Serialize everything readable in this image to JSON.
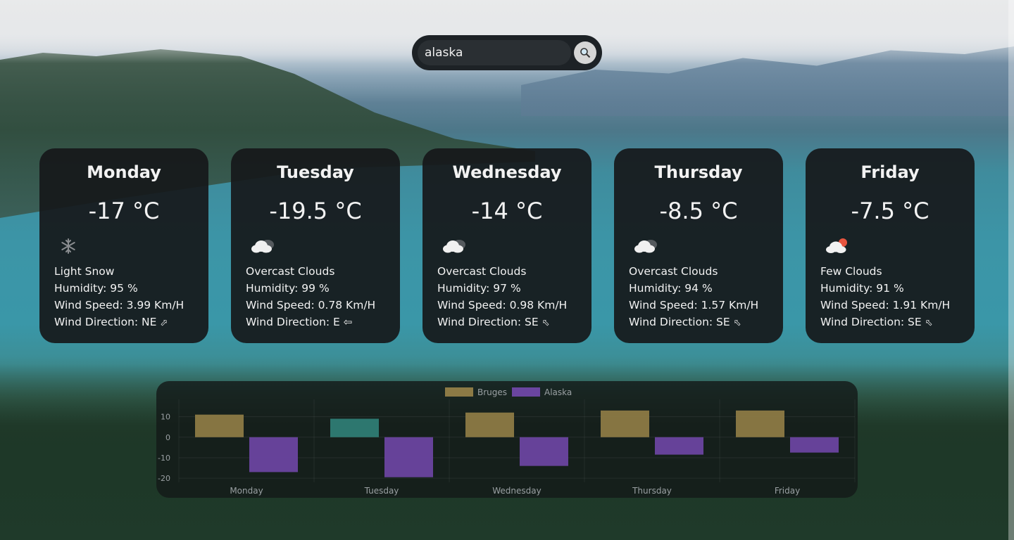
{
  "search": {
    "value": "alaska"
  },
  "cards": [
    {
      "day": "Monday",
      "temp": "-17 °C",
      "icon": "snow-icon",
      "desc": "Light Snow",
      "humidity": "Humidity: 95 %",
      "wind_speed": "Wind Speed: 3.99 Km/H",
      "wind_dir": "Wind Direction: NE",
      "arrow": "⬀"
    },
    {
      "day": "Tuesday",
      "temp": "-19.5 °C",
      "icon": "cloud-icon",
      "desc": "Overcast Clouds",
      "humidity": "Humidity: 99 %",
      "wind_speed": "Wind Speed: 0.78 Km/H",
      "wind_dir": "Wind Direction: E",
      "arrow": "⇦"
    },
    {
      "day": "Wednesday",
      "temp": "-14 °C",
      "icon": "cloud-icon",
      "desc": "Overcast Clouds",
      "humidity": "Humidity: 97 %",
      "wind_speed": "Wind Speed: 0.98 Km/H",
      "wind_dir": "Wind Direction: SE",
      "arrow": "⬁"
    },
    {
      "day": "Thursday",
      "temp": "-8.5 °C",
      "icon": "cloud-icon",
      "desc": "Overcast Clouds",
      "humidity": "Humidity: 94 %",
      "wind_speed": "Wind Speed: 1.57 Km/H",
      "wind_dir": "Wind Direction: SE",
      "arrow": "⬁"
    },
    {
      "day": "Friday",
      "temp": "-7.5 °C",
      "icon": "sun-cloud-icon",
      "desc": "Few Clouds",
      "humidity": "Humidity: 91 %",
      "wind_speed": "Wind Speed: 1.91 Km/H",
      "wind_dir": "Wind Direction: SE",
      "arrow": "⬁"
    }
  ],
  "chart_data": {
    "type": "bar",
    "categories": [
      "Monday",
      "Tuesday",
      "Wednesday",
      "Thursday",
      "Friday"
    ],
    "series": [
      {
        "name": "Bruges",
        "values": [
          11,
          9,
          12,
          13,
          13
        ],
        "color": "#8c7a45",
        "bar_colors": [
          "#8c7a45",
          "#2e7c74",
          "#8c7a45",
          "#8c7a45",
          "#8c7a45"
        ]
      },
      {
        "name": "Alaska",
        "values": [
          -17,
          -19.5,
          -14,
          -8.5,
          -7.5
        ],
        "color": "#6a45a0"
      }
    ],
    "yticks": [
      "10",
      "0",
      "-10",
      "-20"
    ],
    "ylim": [
      -22,
      15
    ],
    "legend": "top-center",
    "grid": true
  }
}
